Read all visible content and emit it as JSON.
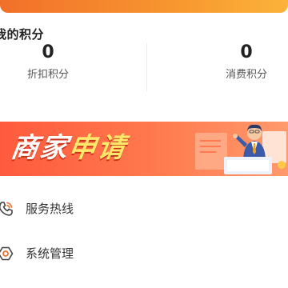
{
  "points": {
    "title": "我的积分",
    "discount": {
      "value": "0",
      "label": "折扣积分"
    },
    "consume": {
      "value": "0",
      "label": "消费积分"
    }
  },
  "banner": {
    "text_white": "商家",
    "text_yellow": "申请"
  },
  "menu": [
    {
      "label": "服务热线",
      "icon": "phone-icon"
    },
    {
      "label": "系统管理",
      "icon": "settings-icon"
    }
  ],
  "colors": {
    "header_orange": "#f26f2a",
    "banner_red": "#ff5a3d",
    "banner_yellow": "#ffe86a"
  }
}
